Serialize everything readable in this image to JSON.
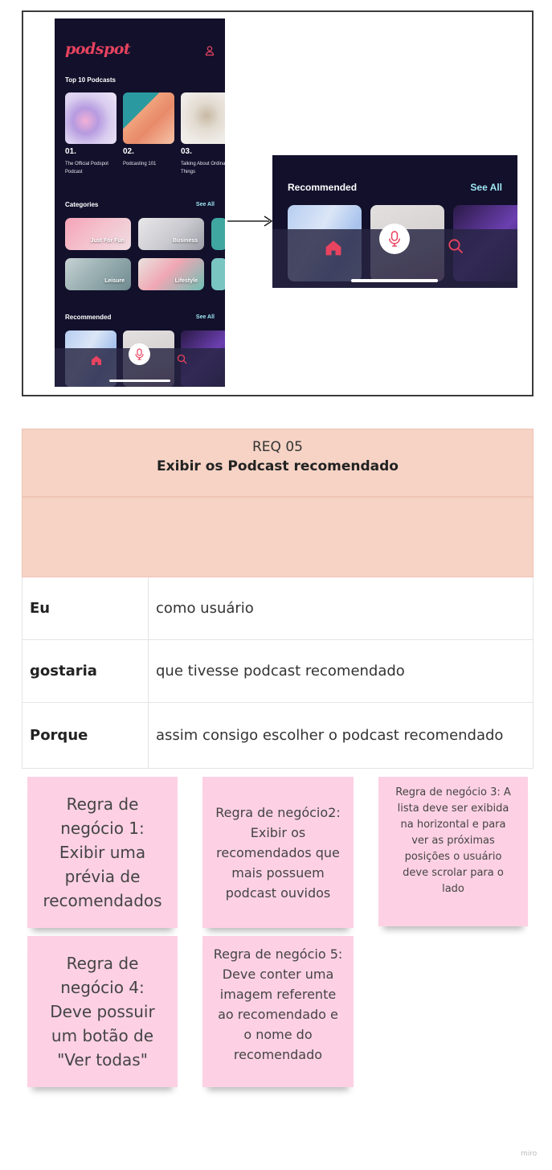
{
  "mockup": {
    "logo": "podspot",
    "top10_title": "Top 10 Podcasts",
    "podcasts": [
      {
        "rank": "01.",
        "name": "The Official Podspot Podcast"
      },
      {
        "rank": "02.",
        "name": "Podcasting 101"
      },
      {
        "rank": "03.",
        "name": "Talking About Ordinary Things"
      }
    ],
    "categories_title": "Categories",
    "see_all": "See All",
    "categories": [
      "Just For Fun",
      "Business",
      "Leisure",
      "Lifestyle"
    ],
    "recommended_title": "Recommended",
    "icons": [
      "user-icon",
      "home-icon",
      "mic-icon",
      "search-icon"
    ],
    "accent_color": "#e8435f",
    "see_all_color": "#9fe7f2",
    "background_color": "#12102b"
  },
  "zoom": {
    "title": "Recommended",
    "see_all": "See All"
  },
  "requirement": {
    "id": "REQ 05",
    "title": "Exibir os Podcast recomendado",
    "rows": [
      {
        "key": "Eu",
        "value": "como usuário"
      },
      {
        "key": "gostaria",
        "value": "que tivesse podcast recomendado"
      },
      {
        "key": "Porque",
        "value": "assim consigo escolher o podcast recomendado"
      }
    ]
  },
  "notes": [
    {
      "text": "Regra de negócio 1: Exibir uma prévia de recomendados"
    },
    {
      "text": "Regra de negócio2: Exibir os recomendados que mais possuem podcast ouvidos"
    },
    {
      "text": "Regra de negócio 3: A lista deve ser exibida na horizontal e para ver as próximas posições o usuário deve scrolar para o lado"
    },
    {
      "text": "Regra de negócio 4: Deve possuir um botão de \"Ver todas\""
    },
    {
      "text": "Regra de negócio 5: Deve conter uma imagem referente ao recomendado e o nome do recomendado"
    }
  ],
  "watermark": "miro"
}
